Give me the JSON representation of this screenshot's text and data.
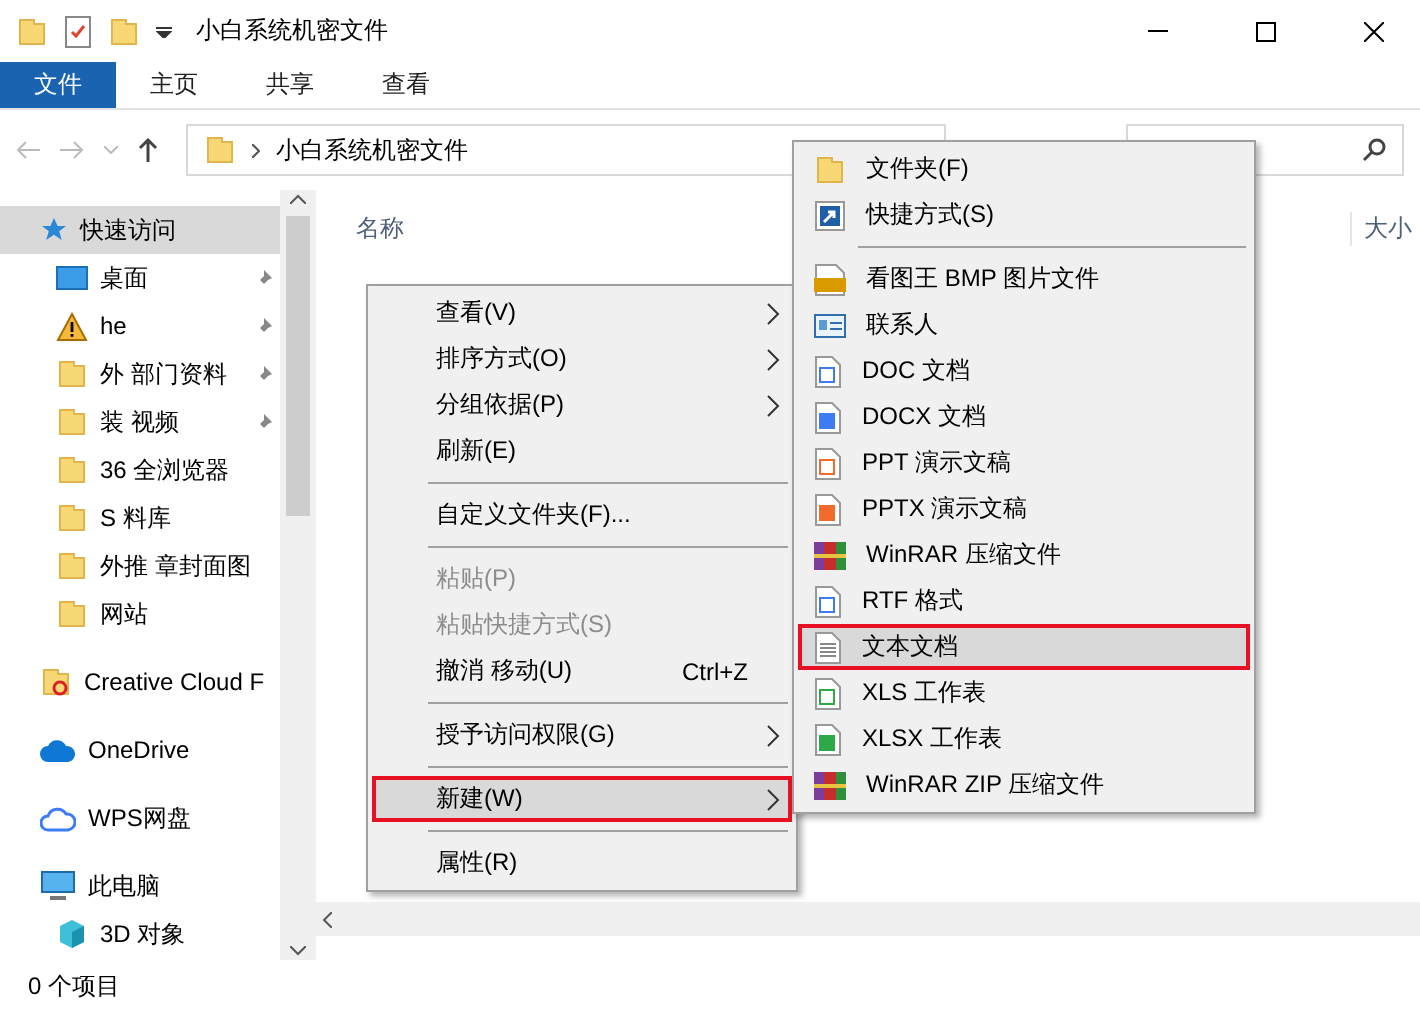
{
  "window": {
    "title": "小白系统机密文件"
  },
  "ribbon_tabs": [
    {
      "label": "文件",
      "selected": true
    },
    {
      "label": "主页",
      "selected": false
    },
    {
      "label": "共享",
      "selected": false
    },
    {
      "label": "查看",
      "selected": false
    }
  ],
  "address_bar": {
    "path": "小白系统机密文件"
  },
  "sidebar": {
    "items": [
      {
        "label": "快速访问",
        "selected": true,
        "pinned": false,
        "children": [
          {
            "label": "桌面",
            "selected": false,
            "pinned": true
          },
          {
            "label": "he",
            "selected": false,
            "pinned": true
          },
          {
            "label": "外 部门资料",
            "selected": false,
            "pinned": true
          },
          {
            "label": "装 视频",
            "selected": false,
            "pinned": true
          },
          {
            "label": "36 全浏览器",
            "selected": false,
            "pinned": false
          },
          {
            "label": "S 料库",
            "selected": false,
            "pinned": false
          },
          {
            "label": "外推 章封面图",
            "selected": false,
            "pinned": false
          },
          {
            "label": "网站",
            "selected": false,
            "pinned": false
          }
        ]
      },
      {
        "label": "Creative Cloud F",
        "selected": false,
        "pinned": false
      },
      {
        "label": "OneDrive",
        "selected": false,
        "pinned": false
      },
      {
        "label": "WPS网盘",
        "selected": false,
        "pinned": false
      },
      {
        "label": "此电脑",
        "selected": false,
        "pinned": false,
        "children": [
          {
            "label": "3D 对象",
            "selected": false,
            "pinned": false
          }
        ]
      }
    ]
  },
  "columns": [
    "名称",
    "大小"
  ],
  "status_bar": {
    "text": "0 个项目"
  },
  "context_menu": {
    "items": [
      {
        "kind": "item",
        "label": "查看(V)",
        "submenu": true,
        "disabled": false,
        "selected": false
      },
      {
        "kind": "item",
        "label": "排序方式(O)",
        "submenu": true,
        "disabled": false,
        "selected": false
      },
      {
        "kind": "item",
        "label": "分组依据(P)",
        "submenu": true,
        "disabled": false,
        "selected": false
      },
      {
        "kind": "item",
        "label": "刷新(E)",
        "submenu": false,
        "disabled": false,
        "selected": false
      },
      {
        "kind": "separator"
      },
      {
        "kind": "item",
        "label": "自定义文件夹(F)...",
        "submenu": false,
        "disabled": false,
        "selected": false
      },
      {
        "kind": "separator"
      },
      {
        "kind": "item",
        "label": "粘贴(P)",
        "submenu": false,
        "disabled": true,
        "selected": false
      },
      {
        "kind": "item",
        "label": "粘贴快捷方式(S)",
        "submenu": false,
        "disabled": true,
        "selected": false
      },
      {
        "kind": "item",
        "label": "撤消 移动(U)",
        "shortcut": "Ctrl+Z",
        "submenu": false,
        "disabled": false,
        "selected": false
      },
      {
        "kind": "separator"
      },
      {
        "kind": "item",
        "label": "授予访问权限(G)",
        "submenu": true,
        "disabled": false,
        "selected": false
      },
      {
        "kind": "separator"
      },
      {
        "kind": "item",
        "label": "新建(W)",
        "submenu": true,
        "disabled": false,
        "selected": true
      },
      {
        "kind": "separator"
      },
      {
        "kind": "item",
        "label": "属性(R)",
        "submenu": false,
        "disabled": false,
        "selected": false
      }
    ]
  },
  "new_submenu": {
    "items": [
      {
        "kind": "item",
        "label": "文件夹(F)",
        "selected": false
      },
      {
        "kind": "item",
        "label": "快捷方式(S)",
        "selected": false
      },
      {
        "kind": "separator"
      },
      {
        "kind": "item",
        "label": "看图王 BMP 图片文件",
        "selected": false
      },
      {
        "kind": "item",
        "label": "联系人",
        "selected": false
      },
      {
        "kind": "item",
        "label": "DOC 文档",
        "selected": false
      },
      {
        "kind": "item",
        "label": "DOCX 文档",
        "selected": false
      },
      {
        "kind": "item",
        "label": "PPT 演示文稿",
        "selected": false
      },
      {
        "kind": "item",
        "label": "PPTX 演示文稿",
        "selected": false
      },
      {
        "kind": "item",
        "label": "WinRAR 压缩文件",
        "selected": false
      },
      {
        "kind": "item",
        "label": "RTF 格式",
        "selected": false
      },
      {
        "kind": "item",
        "label": "文本文档",
        "selected": true
      },
      {
        "kind": "item",
        "label": "XLS 工作表",
        "selected": false
      },
      {
        "kind": "item",
        "label": "XLSX 工作表",
        "selected": false
      },
      {
        "kind": "item",
        "label": "WinRAR ZIP 压缩文件",
        "selected": false
      }
    ]
  }
}
